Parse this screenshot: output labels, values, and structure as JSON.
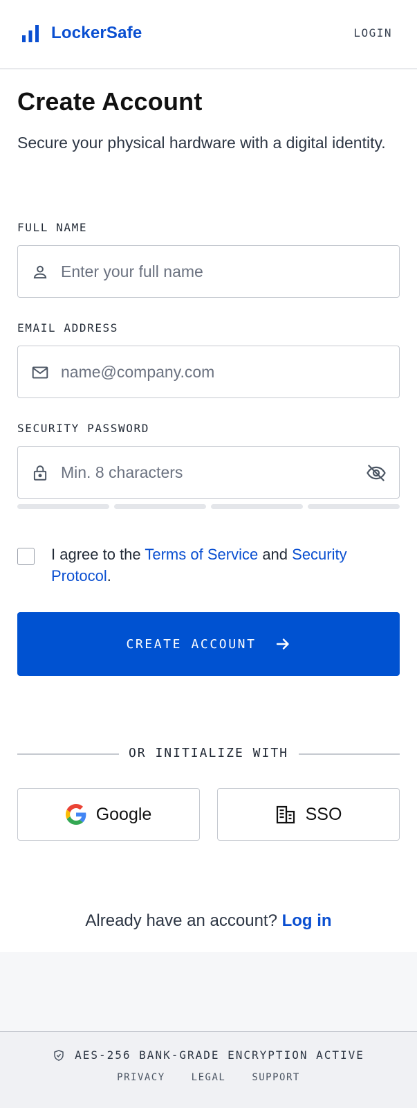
{
  "header": {
    "brand": "LockerSafe",
    "login_label": "LOGIN"
  },
  "page": {
    "title": "Create Account",
    "subtitle": "Secure your physical hardware with a digital identity."
  },
  "form": {
    "full_name": {
      "label": "FULL NAME",
      "placeholder": "Enter your full name",
      "value": "",
      "icon": "user-icon"
    },
    "email": {
      "label": "EMAIL ADDRESS",
      "placeholder": "name@company.com",
      "value": "",
      "icon": "mail-icon"
    },
    "password": {
      "label": "SECURITY PASSWORD",
      "placeholder": "Min. 8 characters",
      "value": "",
      "icon": "lock-icon",
      "toggle_icon": "eye-off-icon",
      "strength_segments": 4,
      "strength_filled": 0
    },
    "agree": {
      "prefix": "I agree to the ",
      "terms_link": "Terms of Service",
      "middle": " and ",
      "security_link": "Security Protocol",
      "suffix": ".",
      "checked": false
    },
    "submit_label": "CREATE ACCOUNT"
  },
  "social": {
    "divider": "OR INITIALIZE WITH",
    "google_label": "Google",
    "sso_label": "SSO"
  },
  "login_prompt": {
    "text": "Already have an account? ",
    "link": "Log in"
  },
  "footer": {
    "encryption": "AES-256 BANK-GRADE ENCRYPTION ACTIVE",
    "links": [
      "PRIVACY",
      "LEGAL",
      "SUPPORT"
    ]
  },
  "colors": {
    "accent": "#0052d1",
    "link": "#0a4fd1",
    "border": "#c5c9d0",
    "footer_bg": "#f0f1f4"
  }
}
